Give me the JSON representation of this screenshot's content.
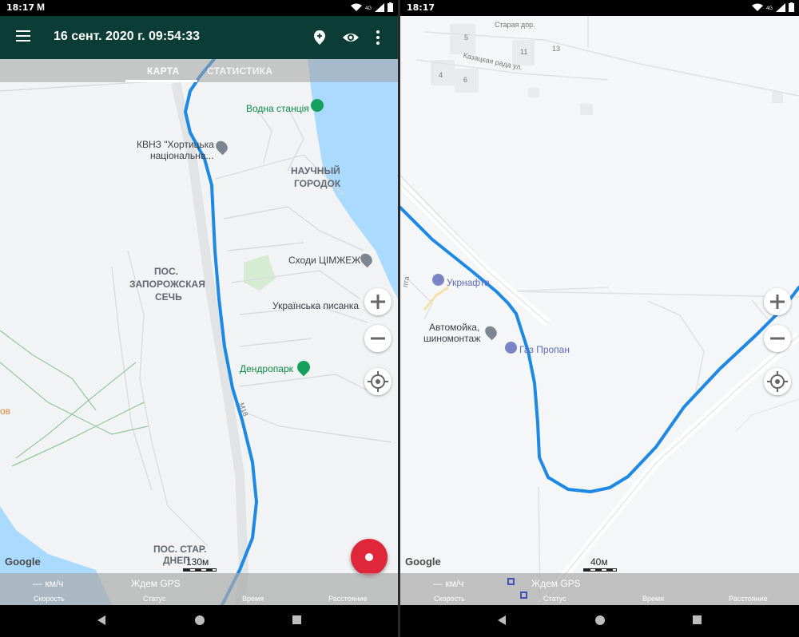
{
  "statusbar": {
    "time": "18:17",
    "network": "4G"
  },
  "appbar": {
    "title": "16 сент. 2020 г. 09:54:33"
  },
  "tabs": [
    {
      "label": "КАРТА"
    },
    {
      "label": "СТАТИСТИКА"
    }
  ],
  "left_map": {
    "labels": {
      "vodna": "Водна станція",
      "kvnz_1": "КВНЗ \"Хортицька",
      "kvnz_2": "національна...",
      "naukovy_1": "НАУЧНЫЙ",
      "naukovy_2": "ГОРОДОК",
      "skhody": "Сходи ЦІМЖЕЖ",
      "zaporozh_1": "ПОС.",
      "zaporozh_2": "ЗАПОРОЖСКАЯ",
      "zaporozh_3": "СЕЧЬ",
      "pysanka": "Українська писанка",
      "dendro": "Дендропарк",
      "ov": "ов",
      "star_1": "ПОС. СТАР.",
      "star_2": "ДНЕП",
      "road": "М18"
    },
    "scale": "130м"
  },
  "right_map": {
    "labels": {
      "staraya": "Старая дор.",
      "kazatska": "Казацкая рада ул.",
      "n5": "5",
      "n11": "11",
      "n13": "13",
      "n4": "4",
      "n6": "6",
      "ukrnafta": "Укрнафта",
      "moyka_1": "Автомойка,",
      "moyka_2": "шиномонтаж",
      "gaz": "Газ Пропан",
      "pta": "пта"
    },
    "scale": "40м"
  },
  "google": "Google",
  "bottombar": {
    "speed_value": "— км/ч",
    "status_value": "Ждем GPS",
    "labels": {
      "speed": "Скорость",
      "status": "Статус",
      "time": "Время",
      "distance": "Расстояние"
    }
  },
  "colors": {
    "appbar": "#0b3d36",
    "track": "#1e88e5",
    "fab": "#e0263a"
  },
  "icons": [
    "menu-icon",
    "map-pin-icon",
    "eye-icon",
    "more-vert-icon",
    "zoom-in-icon",
    "zoom-out-icon",
    "my-location-icon",
    "record-icon",
    "back-icon",
    "home-icon",
    "recents-icon"
  ]
}
